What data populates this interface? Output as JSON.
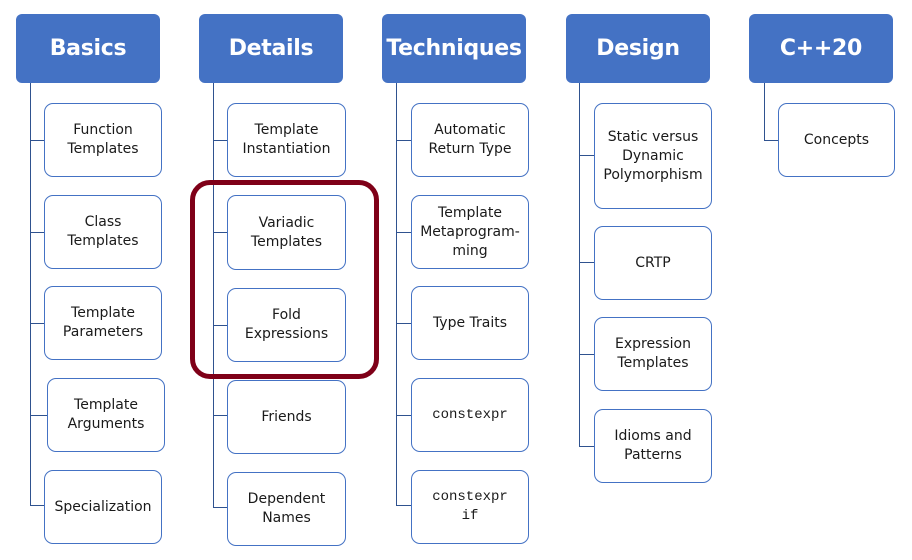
{
  "diagram": {
    "colors": {
      "header_fill": "#4472c4",
      "header_text": "#ffffff",
      "child_border": "#4472c4",
      "connector": "#2f528f",
      "highlight": "#7f0018"
    },
    "columns": [
      {
        "title": "Basics",
        "items": [
          {
            "label": "Function\nTemplates",
            "mono": false
          },
          {
            "label": "Class\nTemplates",
            "mono": false
          },
          {
            "label": "Template\nParameters",
            "mono": false
          },
          {
            "label": "Template\nArguments",
            "mono": false
          },
          {
            "label": "Specialization",
            "mono": false
          }
        ]
      },
      {
        "title": "Details",
        "items": [
          {
            "label": "Template\nInstantiation",
            "mono": false
          },
          {
            "label": "Variadic\nTemplates",
            "mono": false,
            "highlighted": true
          },
          {
            "label": "Fold\nExpressions",
            "mono": false,
            "highlighted": true
          },
          {
            "label": "Friends",
            "mono": false
          },
          {
            "label": "Dependent\nNames",
            "mono": false
          }
        ]
      },
      {
        "title": "Techniques",
        "items": [
          {
            "label": "Automatic\nReturn Type",
            "mono": false
          },
          {
            "label": "Template\nMetaprogram-\nming",
            "mono": false
          },
          {
            "label": "Type Traits",
            "mono": false
          },
          {
            "label": "constexpr",
            "mono": true
          },
          {
            "label": "constexpr\nif",
            "mono": true
          }
        ]
      },
      {
        "title": "Design",
        "items": [
          {
            "label": "Static versus\nDynamic\nPolymorphism",
            "mono": false
          },
          {
            "label": "CRTP",
            "mono": false
          },
          {
            "label": "Expression\nTemplates",
            "mono": false
          },
          {
            "label": "Idioms and\nPatterns",
            "mono": false
          }
        ]
      },
      {
        "title": "C++20",
        "items": [
          {
            "label": "Concepts",
            "mono": false
          }
        ]
      }
    ]
  }
}
